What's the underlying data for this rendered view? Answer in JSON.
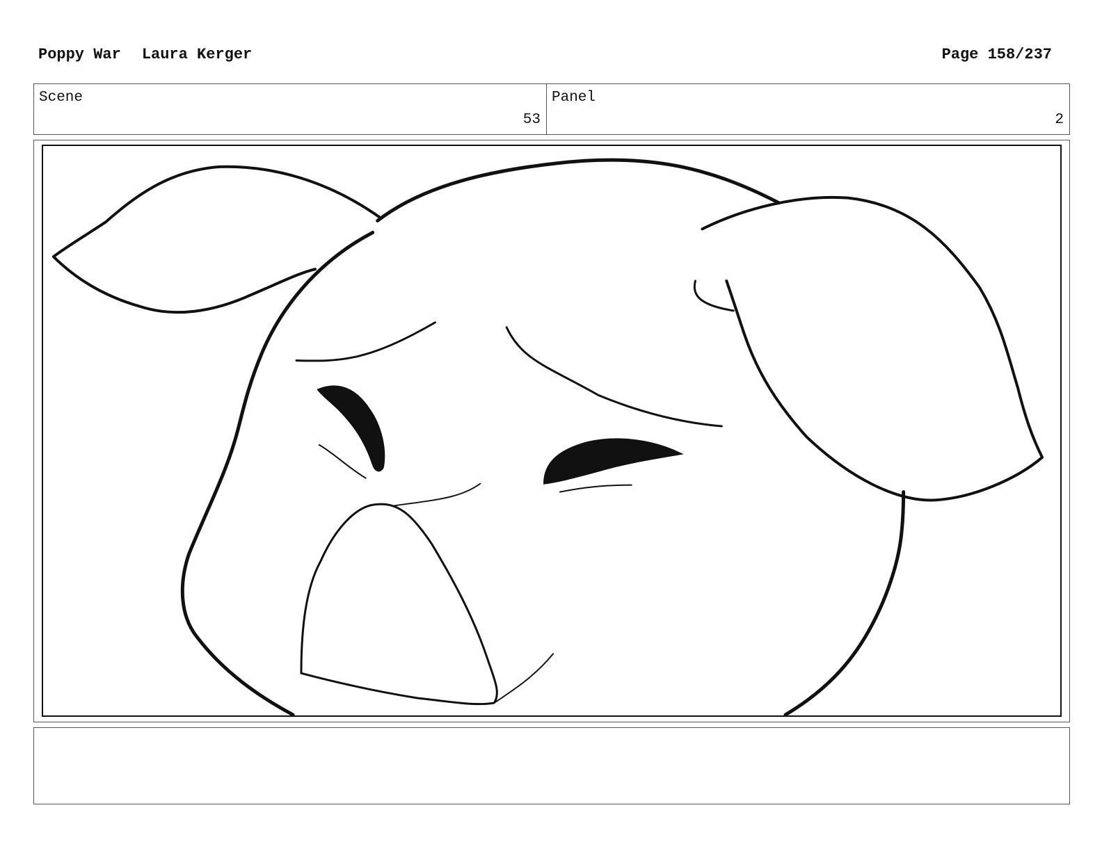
{
  "header": {
    "title": "Poppy War",
    "author": "Laura Kerger",
    "page": "Page 158/237"
  },
  "scene": {
    "label": "Scene",
    "value": "53"
  },
  "panel": {
    "label": "Panel",
    "value": "2"
  },
  "notes": {
    "text": ""
  }
}
